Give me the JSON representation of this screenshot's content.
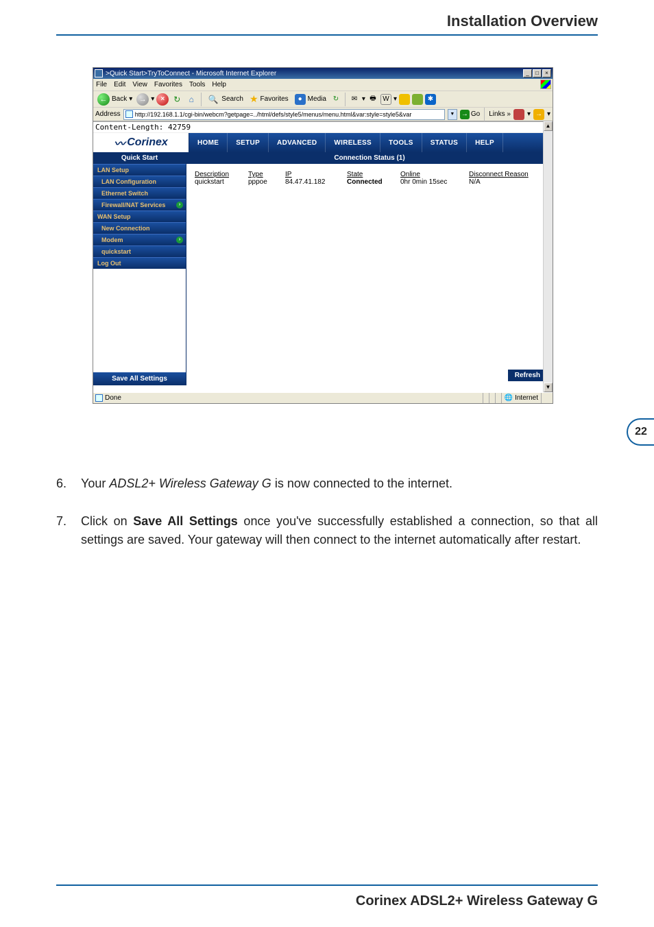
{
  "page": {
    "header": "Installation Overview",
    "page_number": "22",
    "footer": "Corinex ADSL2+ Wireless Gateway G"
  },
  "instructions": {
    "item6": {
      "num": "6.",
      "pre": "Your ",
      "italic": "ADSL2+ Wireless Gateway G",
      "post": " is now connected to the internet."
    },
    "item7": {
      "num": "7.",
      "pre": "Click on ",
      "bold": "Save All Settings",
      "post": " once you've successfully established a connection, so that all settings are saved. Your gateway will then connect to the internet automatically after restart."
    }
  },
  "ie": {
    "title": ">Quick Start>TryToConnect - Microsoft Internet Explorer",
    "win_min": "_",
    "win_max": "□",
    "win_close": "×",
    "menu": {
      "file": "File",
      "edit": "Edit",
      "view": "View",
      "favorites": "Favorites",
      "tools": "Tools",
      "help": "Help"
    },
    "toolbar": {
      "back": "Back",
      "back_arrow": "←",
      "fwd_arrow": "→",
      "stop_x": "×",
      "refresh": "↻",
      "home": "⌂",
      "search": "Search",
      "favorites": "Favorites",
      "media": "Media"
    },
    "address": {
      "label": "Address",
      "url": "http://192.168.1.1/cgi-bin/webcm?getpage=../html/defs/style5/menus/menu.html&var:style=style5&var",
      "go": "Go",
      "go_arrow": "→",
      "links": "Links",
      "links_sym": "»"
    },
    "content_length": "Content-Length: 42759",
    "status": {
      "done": "Done",
      "zone": "Internet"
    }
  },
  "corinex": {
    "logo": "Corinex",
    "nav": {
      "home": "HOME",
      "setup": "SETUP",
      "advanced": "ADVANCED",
      "wireless": "WIRELESS",
      "tools": "TOOLS",
      "status": "STATUS",
      "help": "HELP"
    },
    "sidebar": {
      "quick_start": "Quick Start",
      "lan_setup": "LAN Setup",
      "lan_config": "LAN Configuration",
      "ethernet": "Ethernet Switch",
      "firewall": "Firewall/NAT Services",
      "wan_setup": "WAN Setup",
      "new_conn": "New Connection",
      "modem": "Modem",
      "quickstart_item": "quickstart",
      "logout": "Log Out",
      "save_all": "Save All Settings"
    },
    "panel": {
      "heading": "Connection Status (1)",
      "headers": {
        "desc": "Description",
        "type": "Type",
        "ip": "IP",
        "state": "State",
        "online": "Online",
        "dis": "Disconnect Reason"
      },
      "row": {
        "desc": "quickstart",
        "type": "pppoe",
        "ip": "84.47.41.182",
        "state": "Connected",
        "online": "0hr 0min 15sec",
        "dis": "N/A"
      },
      "refresh": "Refresh"
    }
  }
}
